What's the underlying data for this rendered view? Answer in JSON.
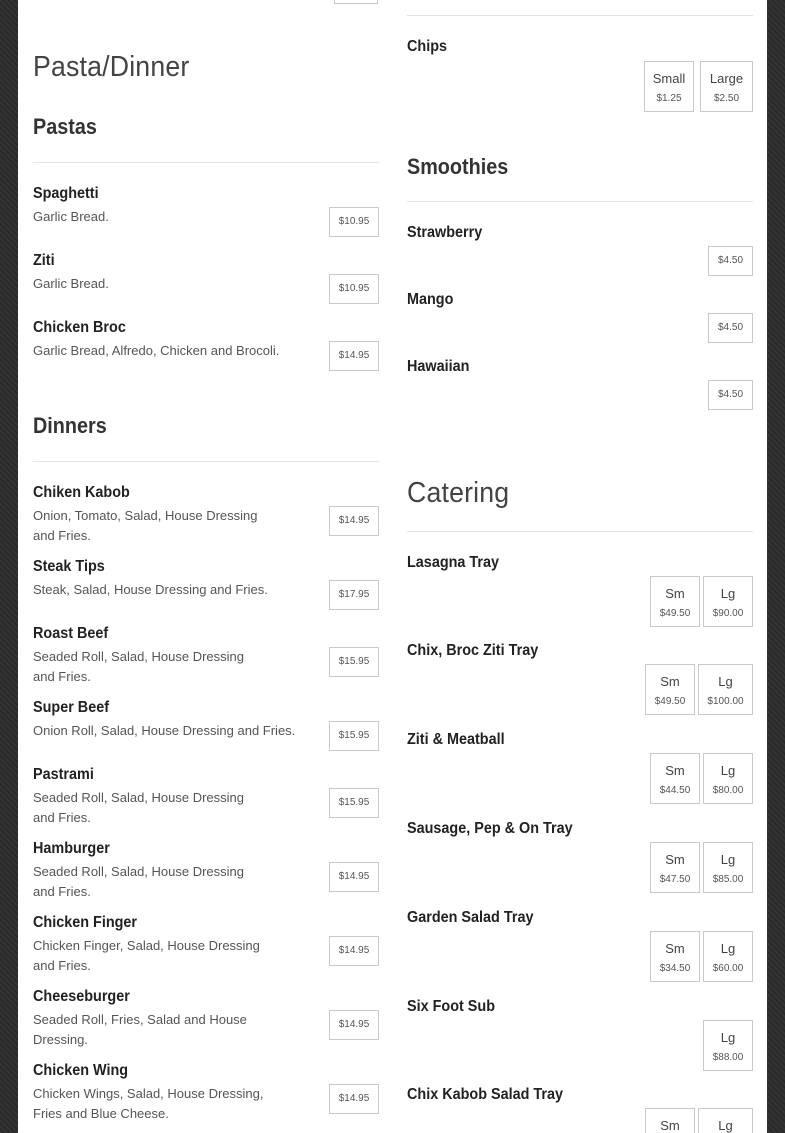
{
  "left": {
    "section_title": "Pasta/Dinner",
    "pastas": {
      "title": "Pastas",
      "items": [
        {
          "name": "Spaghetti",
          "desc": "Garlic Bread.",
          "price": "$10.95"
        },
        {
          "name": "Ziti",
          "desc": "Garlic Bread.",
          "price": "$10.95"
        },
        {
          "name": "Chicken Broc",
          "desc": "Garlic Bread, Alfredo, Chicken and Brocoli.",
          "price": "$14.95"
        }
      ]
    },
    "dinners": {
      "title": "Dinners",
      "items": [
        {
          "name": "Chiken Kabob",
          "desc": "Onion, Tomato, Salad, House Dressing and Fries.",
          "price": "$14.95"
        },
        {
          "name": "Steak Tips",
          "desc": "Steak, Salad, House Dressing and Fries.",
          "price": "$17.95"
        },
        {
          "name": "Roast Beef",
          "desc": "Seaded Roll, Salad, House Dressing and Fries.",
          "price": "$15.95"
        },
        {
          "name": "Super Beef",
          "desc": "Onion Roll, Salad, House Dressing and Fries.",
          "price": "$15.95"
        },
        {
          "name": "Pastrami",
          "desc": "Seaded Roll, Salad, House Dressing and Fries.",
          "price": "$15.95"
        },
        {
          "name": "Hamburger",
          "desc": "Seaded Roll, Salad, House Dressing and Fries.",
          "price": "$14.95"
        },
        {
          "name": "Chicken Finger",
          "desc": "Chicken Finger, Salad, House Dressing and Fries.",
          "price": "$14.95"
        },
        {
          "name": "Cheeseburger",
          "desc": "Seaded Roll, Fries, Salad and House Dressing.",
          "price": "$14.95"
        },
        {
          "name": "Chicken Wing",
          "desc": "Chicken Wings, Salad, House Dressing, Fries and Blue Cheese.",
          "price": "$14.95"
        }
      ]
    }
  },
  "right": {
    "chips": {
      "name": "Chips",
      "sizes": [
        {
          "label": "Small",
          "price": "$1.25"
        },
        {
          "label": "Large",
          "price": "$2.50"
        }
      ]
    },
    "smoothies": {
      "title": "Smoothies",
      "items": [
        {
          "name": "Strawberry",
          "price": "$4.50"
        },
        {
          "name": "Mango",
          "price": "$4.50"
        },
        {
          "name": "Hawaiian",
          "price": "$4.50"
        }
      ]
    },
    "catering": {
      "title": "Catering",
      "items": [
        {
          "name": "Lasagna Tray",
          "sizes": [
            {
              "label": "Sm",
              "price": "$49.50"
            },
            {
              "label": "Lg",
              "price": "$90.00"
            }
          ]
        },
        {
          "name": "Chix, Broc Ziti Tray",
          "sizes": [
            {
              "label": "Sm",
              "price": "$49.50"
            },
            {
              "label": "Lg",
              "price": "$100.00"
            }
          ]
        },
        {
          "name": "Ziti & Meatball",
          "sizes": [
            {
              "label": "Sm",
              "price": "$44.50"
            },
            {
              "label": "Lg",
              "price": "$80.00"
            }
          ]
        },
        {
          "name": "Sausage, Pep & On Tray",
          "sizes": [
            {
              "label": "Sm",
              "price": "$47.50"
            },
            {
              "label": "Lg",
              "price": "$85.00"
            }
          ]
        },
        {
          "name": "Garden Salad Tray",
          "sizes": [
            {
              "label": "Sm",
              "price": "$34.50"
            },
            {
              "label": "Lg",
              "price": "$60.00"
            }
          ]
        },
        {
          "name": "Six Foot Sub",
          "sizes": [
            {
              "label": "Lg",
              "price": "$88.00"
            }
          ]
        },
        {
          "name": "Chix Kabob Salad Tray",
          "sizes": [
            {
              "label": "Sm",
              "price": ""
            },
            {
              "label": "Lg",
              "price": ""
            }
          ]
        }
      ]
    }
  },
  "colors": {
    "page_bg": "#ffffff",
    "backdrop": "#2b2b2b",
    "border": "#c9c9c9",
    "rule": "#e3e3e3"
  }
}
